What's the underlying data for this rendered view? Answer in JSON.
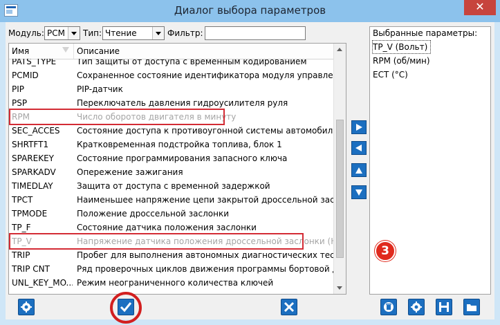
{
  "window": {
    "title": "Диалог выбора параметров",
    "close_label": "✕"
  },
  "filters": {
    "module_label": "Модуль:",
    "module_value": "PCM",
    "type_label": "Тип:",
    "type_value": "Чтение",
    "filter_label": "Фильтр:",
    "filter_value": ""
  },
  "table": {
    "columns": [
      "Имя",
      "Описание"
    ],
    "rows": [
      {
        "name": "PATS_TYPE",
        "desc": "Тип защиты от доступа с временным кодированием"
      },
      {
        "name": "PCMID",
        "desc": "Сохраненное состояние идентификатора модуля управления..."
      },
      {
        "name": "PIP",
        "desc": "PIP-датчик"
      },
      {
        "name": "PSP",
        "desc": "Переключатель давления гидроусилителя руля"
      },
      {
        "name": "RPM",
        "desc": "Число оборотов двигателя в минуту",
        "selected": true
      },
      {
        "name": "SEC_ACCES",
        "desc": "Состояние доступа к противоугонной системы автомобиля"
      },
      {
        "name": "SHRTFT1",
        "desc": "Кратковременная подстройка топлива, блок 1"
      },
      {
        "name": "SPAREKEY",
        "desc": "Состояние программирования запасного ключа"
      },
      {
        "name": "SPARKADV",
        "desc": "Опережение зажигания"
      },
      {
        "name": "TIMEDLAY",
        "desc": "Защита от доступа с временной задержкой"
      },
      {
        "name": "TPCT",
        "desc": "Наименьшее напряжение цепи закрытой дроссельной заслонки"
      },
      {
        "name": "TPMODE",
        "desc": "Положение дроссельной заслонки"
      },
      {
        "name": "TP_F",
        "desc": "Состояние датчика положения заслонки"
      },
      {
        "name": "TP_V",
        "desc": "Напряжение датчика положения дроссельной заслонки (Нап...",
        "selected": true
      },
      {
        "name": "TRIP",
        "desc": "Пробег для выполнения автономных диагностических тестов..."
      },
      {
        "name": "TRIP CNT",
        "desc": "Ряд проверочных циклов движения программы бортовой диа..."
      },
      {
        "name": "UNL_KEY_MO...",
        "desc": "Режим неограниченного количества ключей"
      }
    ]
  },
  "selected_panel": {
    "header": "Выбранные параметры:",
    "items": [
      "TP_V (Вольт)",
      "RPM (об/мин)",
      "ECT (°C)"
    ]
  },
  "move_buttons": [
    "arrow-right-icon",
    "arrow-left-icon",
    "arrow-up-icon",
    "arrow-down-icon"
  ],
  "badge": "3",
  "colors": {
    "accent": "#1c6fc0",
    "highlight": "#d32b34",
    "titlebar": "#8cc2ec"
  }
}
